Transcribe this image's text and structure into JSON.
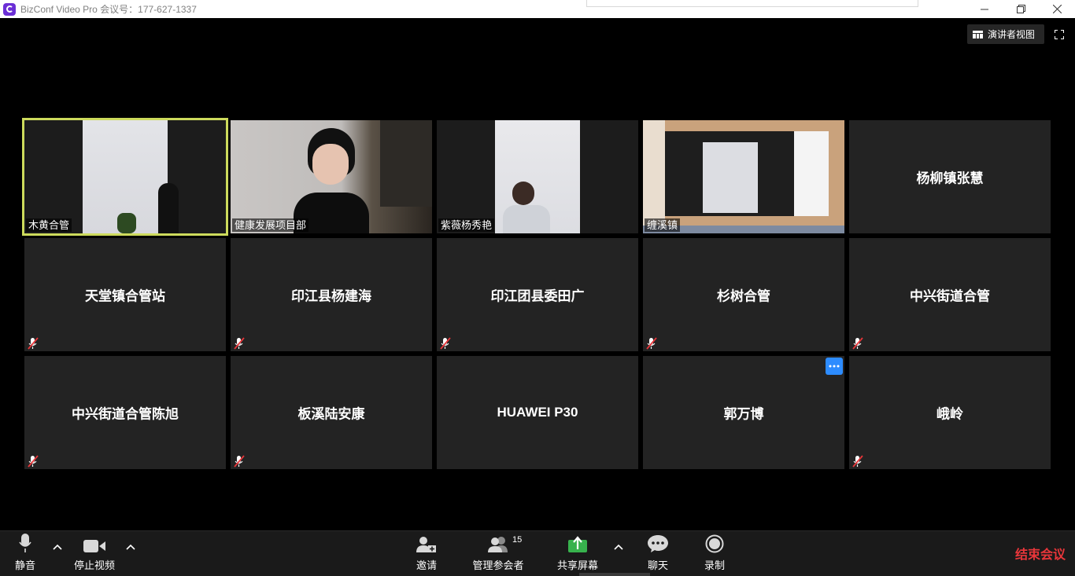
{
  "window": {
    "title": "BizConf Video Pro 会议号：177-627-1337"
  },
  "top_controls": {
    "speaker_view_label": "演讲者视图"
  },
  "participants": [
    {
      "name": "木黄合管",
      "video": true,
      "active": true
    },
    {
      "name": "健康发展项目部",
      "video": true
    },
    {
      "name": "紫薇杨秀艳",
      "video": true
    },
    {
      "name": "缠溪镇",
      "video": true
    },
    {
      "name": "杨柳镇张慧",
      "video": false,
      "muted": false
    },
    {
      "name": "天堂镇合管站",
      "video": false,
      "muted": true
    },
    {
      "name": "印江县杨建海",
      "video": false,
      "muted": true
    },
    {
      "name": "印江团县委田广",
      "video": false,
      "muted": true
    },
    {
      "name": "杉树合管",
      "video": false,
      "muted": true
    },
    {
      "name": "中兴街道合管",
      "video": false,
      "muted": true
    },
    {
      "name": "中兴街道合管陈旭",
      "video": false,
      "muted": true
    },
    {
      "name": "板溪陆安康",
      "video": false,
      "muted": true
    },
    {
      "name": "HUAWEI P30",
      "video": false,
      "muted": false
    },
    {
      "name": "郭万博",
      "video": false,
      "muted": false,
      "more_menu": true
    },
    {
      "name": "峨岭",
      "video": false,
      "muted": true
    }
  ],
  "toolbar": {
    "mute_label": "静音",
    "stop_video_label": "停止视频",
    "invite_label": "邀请",
    "manage_participants_label": "管理参会者",
    "participant_count": "15",
    "share_screen_label": "共享屏幕",
    "chat_label": "聊天",
    "record_label": "录制",
    "end_meeting_label": "结束会议"
  },
  "colors": {
    "active_speaker_border": "#cddb5c",
    "share_green": "#37b24d",
    "end_red": "#e8363a",
    "more_blue": "#2d8cff"
  }
}
